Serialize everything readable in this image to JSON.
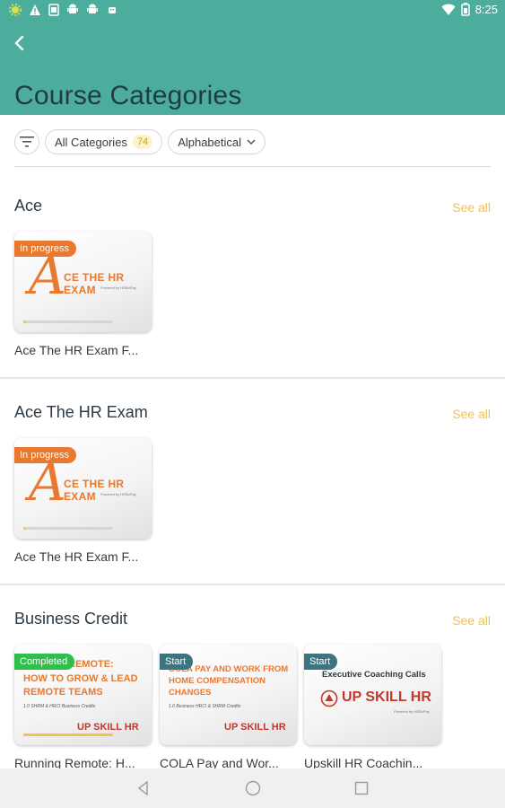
{
  "status_bar": {
    "left_icons": [
      "settings-icon",
      "warning-icon",
      "sim-icon",
      "android-icon",
      "android-icon",
      "android-icon"
    ],
    "time": "8:25",
    "right_icons": [
      "wifi-icon",
      "battery-icon"
    ]
  },
  "header": {
    "title": "Course Categories",
    "back_icon": "back-arrow-icon",
    "color": "#4dad9c"
  },
  "filters": {
    "filter_icon": "filter-icon",
    "category_chip": {
      "label": "All Categories",
      "count": "74"
    },
    "sort_chip": {
      "label": "Alphabetical",
      "icon": "chevron-down-icon"
    }
  },
  "sections": [
    {
      "title": "Ace",
      "see_all": "See all",
      "courses": [
        {
          "title": "Ace The HR Exam F...",
          "badge": "In progress",
          "progress": 0.03,
          "thumb": {
            "line1": "CE THE HR EXAM",
            "big_letter": "A",
            "powered": "Powered by HRBoPay"
          }
        }
      ]
    },
    {
      "title": "Ace The HR Exam",
      "see_all": "See all",
      "courses": [
        {
          "title": "Ace The HR Exam F...",
          "badge": "In progress",
          "progress": 0.03,
          "thumb": {
            "line1": "CE THE HR EXAM",
            "big_letter": "A",
            "powered": "Powered by HRBoPay"
          }
        }
      ]
    },
    {
      "title": "Business Credit",
      "see_all": "See all",
      "courses": [
        {
          "title": "Running Remote: H...",
          "badge": "Completed",
          "progress": 1,
          "thumb": {
            "lines": [
              "REMOTE:",
              "HOW TO GROW & LEAD",
              "REMOTE TEAMS"
            ],
            "credit": "1.0 SHRM & HRCI Business Credits",
            "logo": "UP SKILL HR"
          }
        },
        {
          "title": "COLA Pay and Wor...",
          "badge": "Start",
          "thumb": {
            "lines": [
              "COLA PAY AND WORK FROM",
              "HOME COMPENSATION",
              "CHANGES"
            ],
            "credit": "1.0 Business HRCI & SHRM Credits",
            "logo": "UP SKILL HR"
          }
        },
        {
          "title": "Upskill HR Coachin...",
          "badge": "Start",
          "thumb": {
            "lines": [
              "Executive Coaching Calls"
            ],
            "logo": "UP SKILL HR",
            "powered": "Powered by HRBoPay"
          }
        }
      ]
    }
  ],
  "nav_bar": {
    "back": "nav-back-icon",
    "home": "nav-home-icon",
    "recents": "nav-recents-icon"
  },
  "colors": {
    "accent": "#4dad9c",
    "see_all": "#f2c14e",
    "in_progress": "#e8792f",
    "completed": "#2fbf4a",
    "start": "#3c7480"
  }
}
